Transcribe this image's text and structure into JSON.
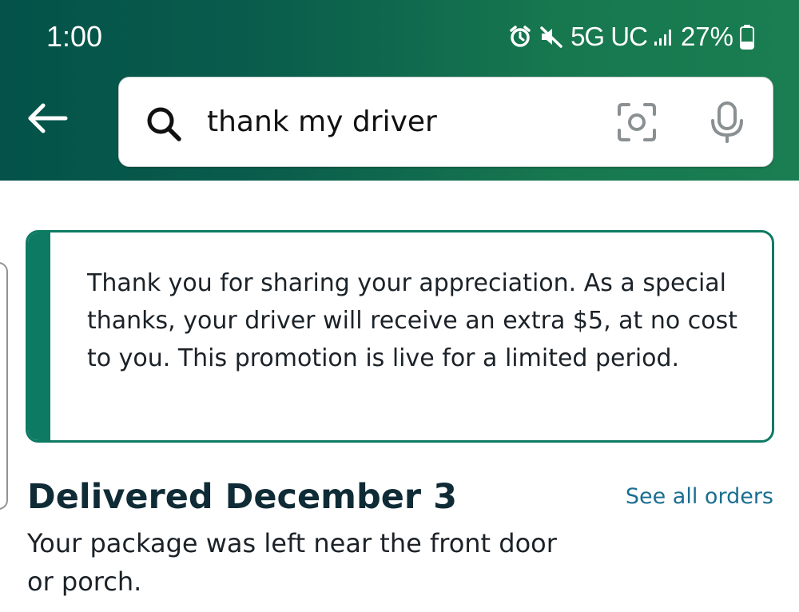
{
  "status_bar": {
    "time": "1:00",
    "network": "5G UC",
    "battery": "27%",
    "icons": [
      "alarm-icon",
      "mute-icon",
      "signal-icon",
      "battery-icon"
    ]
  },
  "header": {
    "back_icon": "back-arrow-icon",
    "search": {
      "query": "thank my driver",
      "icons": [
        "search-icon",
        "camera-icon",
        "microphone-icon"
      ]
    }
  },
  "promo": {
    "text": "Thank you for sharing your appreciation. As a special thanks, your driver will receive an extra $5, at no cost to you. This promotion is live for a limited period."
  },
  "delivery": {
    "title": "Delivered December 3",
    "see_all_label": "See all orders",
    "description": "Your package was left near the front door or porch."
  },
  "colors": {
    "header_start": "#04524a",
    "header_end": "#1a7e52",
    "accent": "#0d7a64",
    "link": "#1b6e91",
    "title": "#0f2b36"
  }
}
